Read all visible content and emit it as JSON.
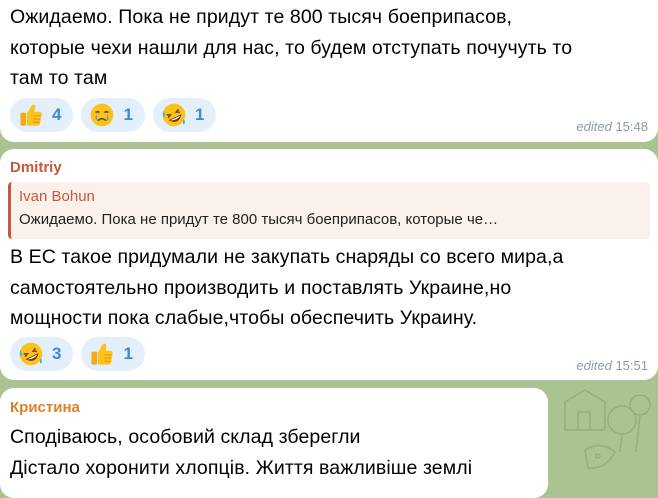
{
  "messages": [
    {
      "text": "Ожидаемо. Пока не придут те 800 тысяч боеприпасов,\nкоторые чехи нашли для нас, то будем отступать почучуть то\nтам то там",
      "reactions": [
        {
          "emoji": "thumbs-up",
          "count": "4"
        },
        {
          "emoji": "crying-face",
          "count": "1"
        },
        {
          "emoji": "rolling-laughing",
          "count": "1"
        }
      ],
      "edited": "edited",
      "time": "15:48"
    },
    {
      "author": "Dmitriy",
      "author_color": "#c45a3a",
      "reply": {
        "name": "Ivan Bohun",
        "text": "Ожидаемо. Пока не придут те 800 тысяч боеприпасов, которые че…"
      },
      "text": "В ЕС такое придумали не закупать снаряды со всего мира,а\nсамостоятельно производить и поставлять Украине,но\nмощности пока слабые,чтобы обеспечить Украину.",
      "reactions": [
        {
          "emoji": "rolling-laughing",
          "count": "3"
        },
        {
          "emoji": "thumbs-up",
          "count": "1"
        }
      ],
      "edited": "edited",
      "time": "15:51"
    },
    {
      "author": "Кристина",
      "author_color": "#d9822b",
      "text": "Сподіваюсь, особовий склад зберегли\nДістало хоронити хлопців. Життя важливіше землі"
    }
  ],
  "colors": {
    "background": "#a9c491",
    "bubble": "#ffffff",
    "reaction_bg": "#e3f0fb",
    "reaction_count": "#3a8ad8",
    "meta": "#8f9aa3"
  }
}
